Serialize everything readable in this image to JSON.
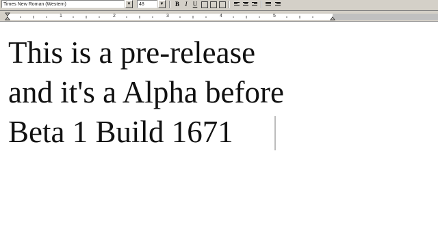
{
  "toolbar": {
    "font_name": "Times New Roman (Western)",
    "font_size": "48",
    "bold_label": "B",
    "italic_label": "I",
    "underline_label": "U"
  },
  "ruler": {
    "numbers": [
      "1",
      "2",
      "3",
      "4",
      "5"
    ]
  },
  "document": {
    "lines": [
      "This is a pre-release",
      "and it's a Alpha before",
      "Beta 1 Build 1671"
    ]
  }
}
